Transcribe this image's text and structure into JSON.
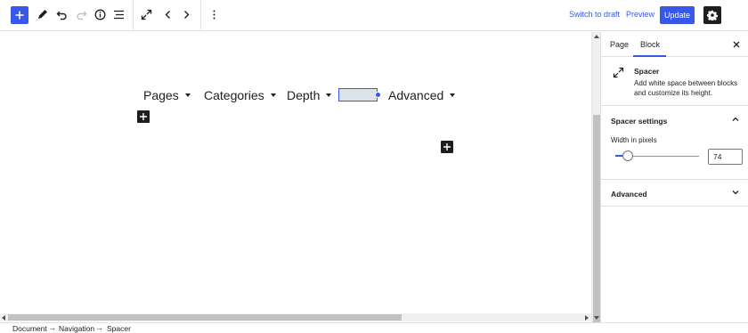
{
  "toolbar": {
    "inserter_icon": "plus-icon",
    "tools_icon": "pencil-icon",
    "undo_icon": "undo-icon",
    "redo_icon": "redo-icon",
    "details_icon": "info-icon",
    "list_view_icon": "list-view-icon",
    "fullscreen_icon": "expand-icon",
    "prev_icon": "chevron-left-icon",
    "next_icon": "chevron-right-icon",
    "more_icon": "more-vertical-icon",
    "switch_to_draft": "Switch to draft",
    "preview": "Preview",
    "update": "Update",
    "settings_icon": "gear-icon",
    "accent_color": "#3858e9"
  },
  "canvas": {
    "nav_items": [
      {
        "label": "Pages"
      },
      {
        "label": "Categories"
      },
      {
        "label": "Depth"
      },
      {
        "label": "Advanced"
      }
    ]
  },
  "sidebar": {
    "tabs": [
      {
        "label": "Page",
        "active": false
      },
      {
        "label": "Block",
        "active": true
      }
    ],
    "close_icon": "close-icon",
    "block": {
      "title": "Spacer",
      "description": "Add white space between blocks and customize its height."
    },
    "spacer_settings": {
      "title": "Spacer settings",
      "width_label": "Width in pixels",
      "width_value": "74"
    },
    "advanced": {
      "title": "Advanced"
    }
  },
  "breadcrumb": {
    "items": [
      "Document",
      "Navigation",
      "Spacer"
    ],
    "separator": "→"
  }
}
